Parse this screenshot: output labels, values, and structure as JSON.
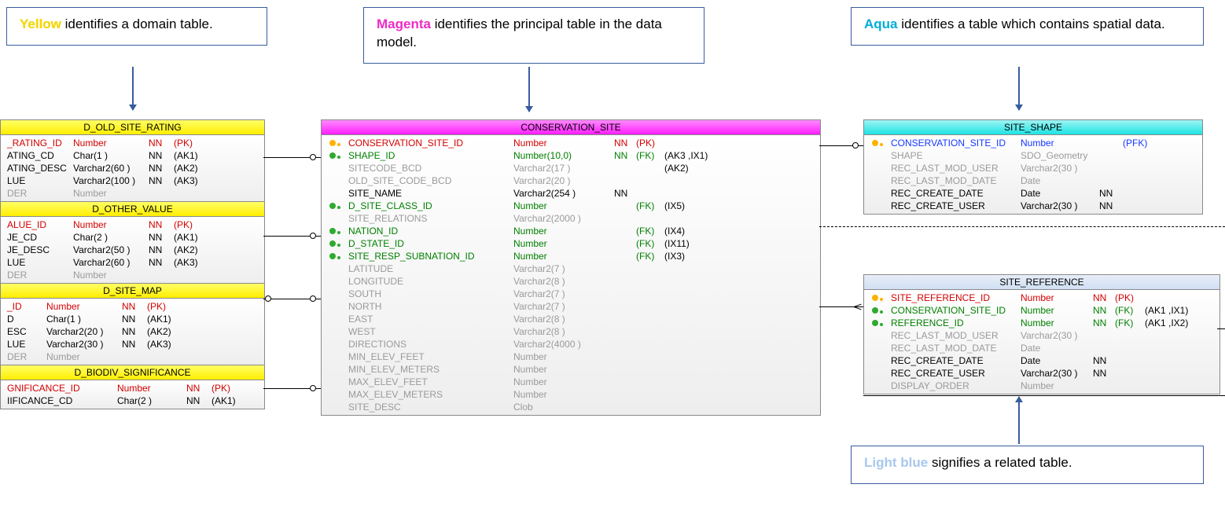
{
  "callouts": {
    "yellow": {
      "word": "Yellow",
      "rest": " identifies a domain table."
    },
    "magenta": {
      "word": "Magenta",
      "rest": " identifies the principal table in the data model."
    },
    "aqua": {
      "word": "Aqua",
      "rest": " identifies a table which contains spatial data."
    },
    "lightblue": {
      "word": "Light blue",
      "rest": " signifies a related table."
    }
  },
  "tables": {
    "d_old_site_rating": {
      "title": "D_OLD_SITE_RATING",
      "rows": [
        {
          "n": "_RATING_ID",
          "t": "Number",
          "nn": "NN",
          "k": "(PK)",
          "cls": "pk",
          "ic": "pk"
        },
        {
          "n": "ATING_CD",
          "t": "Char(1 )",
          "nn": "NN",
          "k": "(AK1)",
          "cls": "nn"
        },
        {
          "n": "ATING_DESC",
          "t": "Varchar2(60 )",
          "nn": "NN",
          "k": "(AK2)",
          "cls": "nn"
        },
        {
          "n": "LUE",
          "t": "Varchar2(100 )",
          "nn": "NN",
          "k": "(AK3)",
          "cls": "nn"
        },
        {
          "n": "DER",
          "t": "Number",
          "nn": "",
          "k": "",
          "cls": "gy"
        }
      ]
    },
    "d_other_value": {
      "title": "D_OTHER_VALUE",
      "rows": [
        {
          "n": "ALUE_ID",
          "t": "Number",
          "nn": "NN",
          "k": "(PK)",
          "cls": "pk",
          "ic": "pk"
        },
        {
          "n": "JE_CD",
          "t": "Char(2 )",
          "nn": "NN",
          "k": "(AK1)",
          "cls": "nn"
        },
        {
          "n": "JE_DESC",
          "t": "Varchar2(50 )",
          "nn": "NN",
          "k": "(AK2)",
          "cls": "nn"
        },
        {
          "n": "LUE",
          "t": "Varchar2(60 )",
          "nn": "NN",
          "k": "(AK3)",
          "cls": "nn"
        },
        {
          "n": "DER",
          "t": "Number",
          "nn": "",
          "k": "",
          "cls": "gy"
        }
      ]
    },
    "d_site_map": {
      "title": "D_SITE_MAP",
      "rows": [
        {
          "n": "_ID",
          "t": "Number",
          "nn": "NN",
          "k": "(PK)",
          "cls": "pk",
          "ic": "pk"
        },
        {
          "n": "D",
          "t": "Char(1 )",
          "nn": "NN",
          "k": "(AK1)",
          "cls": "nn"
        },
        {
          "n": "ESC",
          "t": "Varchar2(20 )",
          "nn": "NN",
          "k": "(AK2)",
          "cls": "nn"
        },
        {
          "n": "LUE",
          "t": "Varchar2(30 )",
          "nn": "NN",
          "k": "(AK3)",
          "cls": "nn"
        },
        {
          "n": "DER",
          "t": "Number",
          "nn": "",
          "k": "",
          "cls": "gy"
        }
      ]
    },
    "d_biodiv_sig": {
      "title": "D_BIODIV_SIGNIFICANCE",
      "rows": [
        {
          "n": "GNIFICANCE_ID",
          "t": "Number",
          "nn": "NN",
          "k": "(PK)",
          "cls": "pk",
          "ic": "pk"
        },
        {
          "n": "IIFICANCE_CD",
          "t": "Char(2 )",
          "nn": "NN",
          "k": "(AK1)",
          "cls": "nn"
        }
      ]
    },
    "conservation_site": {
      "title": "CONSERVATION_SITE",
      "rows": [
        {
          "n": "CONSERVATION_SITE_ID",
          "t": "Number",
          "nn": "NN",
          "k": "(PK)",
          "cls": "pk",
          "ic": "pk"
        },
        {
          "n": "SHAPE_ID",
          "t": "Number(10,0)",
          "nn": "NN",
          "k": "(FK)",
          "idx": "(AK3 ,IX1)",
          "cls": "fk",
          "ic": "fk"
        },
        {
          "n": "SITECODE_BCD",
          "t": "Varchar2(17 )",
          "nn": "",
          "k": "",
          "idx": "(AK2)",
          "cls": "gy"
        },
        {
          "n": "OLD_SITE_CODE_BCD",
          "t": "Varchar2(20 )",
          "nn": "",
          "k": "",
          "cls": "gy"
        },
        {
          "n": "SITE_NAME",
          "t": "Varchar2(254 )",
          "nn": "NN",
          "k": "",
          "cls": "nn"
        },
        {
          "n": "D_SITE_CLASS_ID",
          "t": "Number",
          "nn": "",
          "k": "(FK)",
          "idx": "(IX5)",
          "cls": "fk",
          "ic": "fk"
        },
        {
          "n": "SITE_RELATIONS",
          "t": "Varchar2(2000 )",
          "nn": "",
          "k": "",
          "cls": "gy"
        },
        {
          "n": "NATION_ID",
          "t": "Number",
          "nn": "",
          "k": "(FK)",
          "idx": "(IX4)",
          "cls": "fk",
          "ic": "fk"
        },
        {
          "n": "D_STATE_ID",
          "t": "Number",
          "nn": "",
          "k": "(FK)",
          "idx": "(IX11)",
          "cls": "fk",
          "ic": "fk"
        },
        {
          "n": "SITE_RESP_SUBNATION_ID",
          "t": "Number",
          "nn": "",
          "k": "(FK)",
          "idx": "(IX3)",
          "cls": "fk",
          "ic": "fk"
        },
        {
          "n": "LATITUDE",
          "t": "Varchar2(7 )",
          "nn": "",
          "k": "",
          "cls": "gy"
        },
        {
          "n": "LONGITUDE",
          "t": "Varchar2(8 )",
          "nn": "",
          "k": "",
          "cls": "gy"
        },
        {
          "n": "SOUTH",
          "t": "Varchar2(7 )",
          "nn": "",
          "k": "",
          "cls": "gy"
        },
        {
          "n": "NORTH",
          "t": "Varchar2(7 )",
          "nn": "",
          "k": "",
          "cls": "gy"
        },
        {
          "n": "EAST",
          "t": "Varchar2(8 )",
          "nn": "",
          "k": "",
          "cls": "gy"
        },
        {
          "n": "WEST",
          "t": "Varchar2(8 )",
          "nn": "",
          "k": "",
          "cls": "gy"
        },
        {
          "n": "DIRECTIONS",
          "t": "Varchar2(4000 )",
          "nn": "",
          "k": "",
          "cls": "gy"
        },
        {
          "n": "MIN_ELEV_FEET",
          "t": "Number",
          "nn": "",
          "k": "",
          "cls": "gy"
        },
        {
          "n": "MIN_ELEV_METERS",
          "t": "Number",
          "nn": "",
          "k": "",
          "cls": "gy"
        },
        {
          "n": "MAX_ELEV_FEET",
          "t": "Number",
          "nn": "",
          "k": "",
          "cls": "gy"
        },
        {
          "n": "MAX_ELEV_METERS",
          "t": "Number",
          "nn": "",
          "k": "",
          "cls": "gy"
        },
        {
          "n": "SITE_DESC",
          "t": "Clob",
          "nn": "",
          "k": "",
          "cls": "gy"
        }
      ]
    },
    "site_shape": {
      "title": "SITE_SHAPE",
      "rows": [
        {
          "n": "CONSERVATION_SITE_ID",
          "t": "Number",
          "nn": "",
          "k": "(PFK)",
          "cls": "bl",
          "ic": "pk"
        },
        {
          "n": "SHAPE",
          "t": "SDO_Geometry",
          "nn": "",
          "k": "",
          "cls": "gy"
        },
        {
          "n": "REC_LAST_MOD_USER",
          "t": "Varchar2(30 )",
          "nn": "",
          "k": "",
          "cls": "gy"
        },
        {
          "n": "REC_LAST_MOD_DATE",
          "t": "Date",
          "nn": "",
          "k": "",
          "cls": "gy"
        },
        {
          "n": "REC_CREATE_DATE",
          "t": "Date",
          "nn": "NN",
          "k": "",
          "cls": "nn"
        },
        {
          "n": "REC_CREATE_USER",
          "t": "Varchar2(30 )",
          "nn": "NN",
          "k": "",
          "cls": "nn"
        }
      ]
    },
    "site_reference": {
      "title": "SITE_REFERENCE",
      "rows": [
        {
          "n": "SITE_REFERENCE_ID",
          "t": "Number",
          "nn": "NN",
          "k": "(PK)",
          "cls": "pk",
          "ic": "pk"
        },
        {
          "n": "CONSERVATION_SITE_ID",
          "t": "Number",
          "nn": "NN",
          "k": "(FK)",
          "idx": "(AK1 ,IX1)",
          "cls": "fk",
          "ic": "fk"
        },
        {
          "n": "REFERENCE_ID",
          "t": "Number",
          "nn": "NN",
          "k": "(FK)",
          "idx": "(AK1 ,IX2)",
          "cls": "fk",
          "ic": "fk"
        },
        {
          "n": "REC_LAST_MOD_USER",
          "t": "Varchar2(30 )",
          "nn": "",
          "k": "",
          "cls": "gy"
        },
        {
          "n": "REC_LAST_MOD_DATE",
          "t": "Date",
          "nn": "",
          "k": "",
          "cls": "gy"
        },
        {
          "n": "REC_CREATE_DATE",
          "t": "Date",
          "nn": "NN",
          "k": "",
          "cls": "nn"
        },
        {
          "n": "REC_CREATE_USER",
          "t": "Varchar2(30 )",
          "nn": "NN",
          "k": "",
          "cls": "nn"
        },
        {
          "n": "DISPLAY_ORDER",
          "t": "Number",
          "nn": "",
          "k": "",
          "cls": "gy"
        }
      ]
    }
  }
}
